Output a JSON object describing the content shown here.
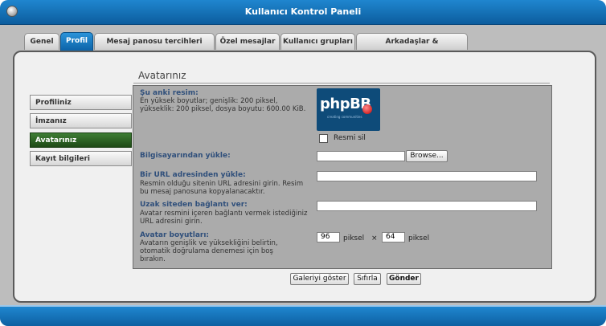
{
  "window": {
    "title": "Kullanıcı Kontrol Paneli"
  },
  "tabs": [
    {
      "label": "Genel"
    },
    {
      "label": "Profil"
    },
    {
      "label": "Mesaj panosu tercihleri"
    },
    {
      "label": "Özel mesajlar"
    },
    {
      "label": "Kullanıcı grupları"
    },
    {
      "label": "Arkadaşlar & Engellenenler"
    }
  ],
  "active_tab": "Profil",
  "sidebar": {
    "items": [
      {
        "label": "Profiliniz"
      },
      {
        "label": "İmzanız"
      },
      {
        "label": "Avatarınız"
      },
      {
        "label": "Kayıt bilgileri"
      }
    ],
    "active": "Avatarınız"
  },
  "page": {
    "heading": "Avatarınız"
  },
  "form": {
    "current": {
      "label": "Şu anki resim:",
      "desc": "En yüksek boyutlar; genişlik: 200 piksel, yükseklik: 200 piksel, dosya boyutu: 600.00 KiB.",
      "logo_text": "phpBB",
      "logo_sub": "creating communities",
      "delete_label": "Resmi sil"
    },
    "upload": {
      "label": "Bilgisayarından yükle:",
      "browse_label": "Browse..."
    },
    "url": {
      "label": "Bir URL adresinden yükle:",
      "desc": "Resmin olduğu sitenin URL adresini girin. Resim bu mesaj panosuna kopyalanacaktır."
    },
    "remote": {
      "label": "Uzak siteden bağlantı ver:",
      "desc": "Avatar resmini içeren bağlantı vermek istediğiniz URL adresini girin."
    },
    "dimensions": {
      "label": "Avatar boyutları:",
      "desc": "Avatarın genişlik ve yüksekliğini belirtin, otomatik doğrulama denemesi için boş bırakın.",
      "width": "96",
      "height": "64",
      "unit": "piksel",
      "times": "×"
    }
  },
  "buttons": {
    "gallery": "Galeriyi göster",
    "reset": "Sıfırla",
    "submit": "Gönder"
  },
  "colors": {
    "accent": "#0c63a8",
    "active_side": "#2f5f26"
  }
}
